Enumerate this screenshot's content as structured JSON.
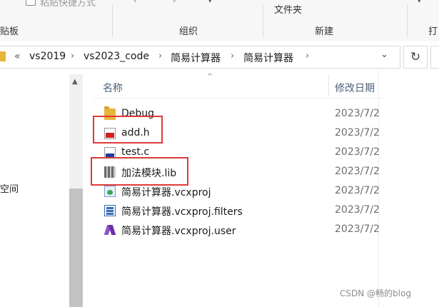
{
  "ribbon": {
    "paste_shortcut_label": "粘贴快捷方式",
    "clipboard_group": "贴板",
    "organize_group": "组织",
    "folder_label": "文件夹",
    "new_group": "新建",
    "open_group_partial": "打"
  },
  "address_bar": {
    "overflow": "«",
    "crumbs": [
      "vs2019",
      "vs2023_code",
      "简易计算器",
      "简易计算器"
    ],
    "separator": "›",
    "dropdown": "⌄",
    "refresh": "↻"
  },
  "nav_pane": {
    "visible_item": "空间"
  },
  "columns": {
    "name": "名称",
    "modified": "修改日期"
  },
  "files": [
    {
      "name": "Debug",
      "type": "folder",
      "icon": "folder-icon",
      "date": "2023/7/2"
    },
    {
      "name": "add.h",
      "type": "header",
      "icon": "header-file-icon",
      "date": "2023/7/2"
    },
    {
      "name": "test.c",
      "type": "c-source",
      "icon": "c-source-file-icon",
      "date": "2023/7/2"
    },
    {
      "name": "加法模块.lib",
      "type": "lib",
      "icon": "library-file-icon",
      "date": "2023/7/2"
    },
    {
      "name": "简易计算器.vcxproj",
      "type": "vcxproj",
      "icon": "vc-project-file-icon",
      "date": "2023/7/2"
    },
    {
      "name": "简易计算器.vcxproj.filters",
      "type": "filters",
      "icon": "project-filters-file-icon",
      "date": "2023/7/2"
    },
    {
      "name": "简易计算器.vcxproj.user",
      "type": "user",
      "icon": "visual-studio-user-file-icon",
      "date": "2023/7/2"
    }
  ],
  "highlight_color": "#e0393a",
  "watermark": "CSDN @畅的blog"
}
